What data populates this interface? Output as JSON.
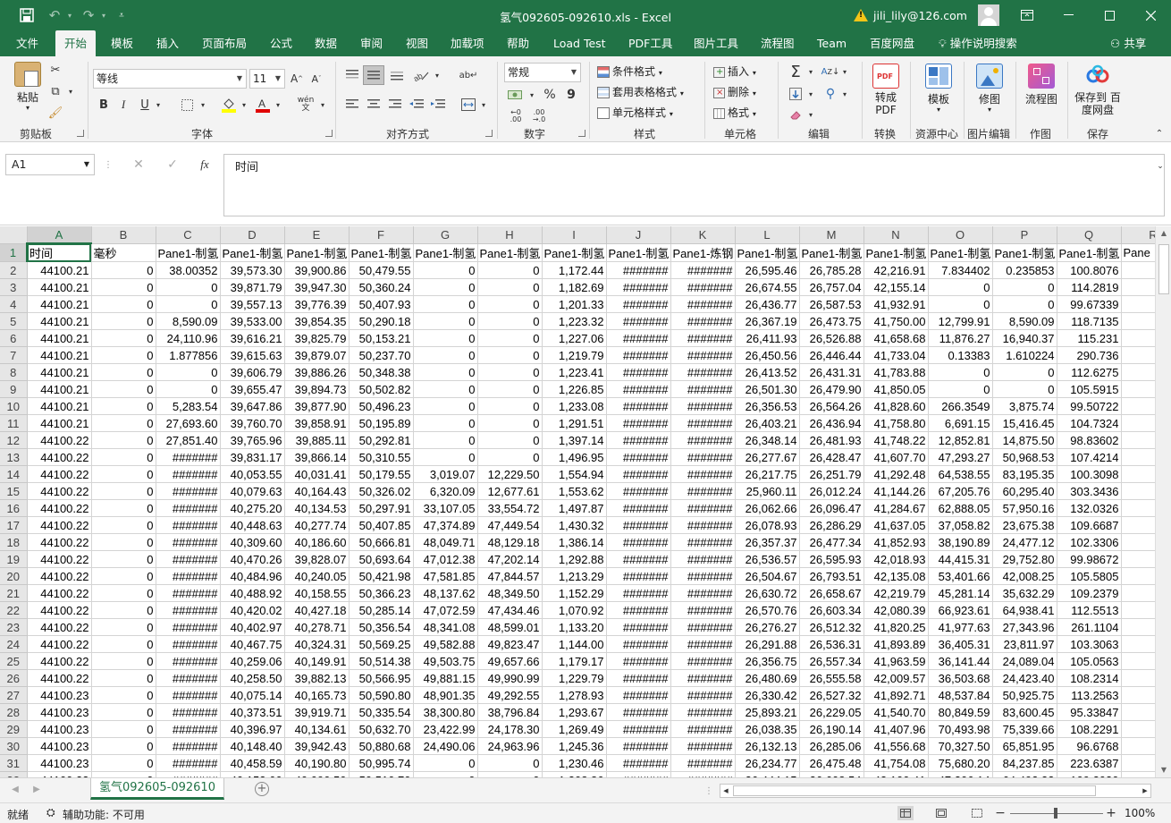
{
  "window": {
    "title": "氢气092605-092610.xls  -  Excel",
    "user": "jili_lily@126.com"
  },
  "colors": {
    "accent": "#217346"
  },
  "tabs": [
    "文件",
    "开始",
    "模板",
    "插入",
    "页面布局",
    "公式",
    "数据",
    "审阅",
    "视图",
    "加载项",
    "帮助",
    "Load Test",
    "PDF工具",
    "图片工具",
    "流程图",
    "Team",
    "百度网盘"
  ],
  "search_hint": "操作说明搜索",
  "share_label": "共享",
  "ribbon": {
    "clipboard": {
      "paste": "粘贴",
      "group": "剪贴板"
    },
    "font": {
      "name": "等线",
      "size": "11",
      "group": "字体",
      "bold": "B",
      "italic": "I",
      "underline": "U",
      "phonetic": "wén"
    },
    "alignment": {
      "group": "对齐方式"
    },
    "number": {
      "format": "常规",
      "group": "数字",
      "percent": "%",
      "comma": "9"
    },
    "styles": {
      "conditional": "条件格式",
      "table": "套用表格格式",
      "cell": "单元格样式",
      "group": "样式"
    },
    "cells": {
      "insert": "插入",
      "delete": "删除",
      "format": "格式",
      "group": "单元格"
    },
    "editing": {
      "group": "编辑"
    },
    "convert": {
      "button": "转成 PDF",
      "group": "转换"
    },
    "resources": {
      "button": "模板",
      "group": "资源中心"
    },
    "imageedit": {
      "button": "修图",
      "group": "图片编辑"
    },
    "drawing": {
      "button": "流程图",
      "group": "作图"
    },
    "save": {
      "button": "保存到 百度网盘",
      "group": "保存"
    }
  },
  "formula": {
    "cell_ref": "A1",
    "content": "时间",
    "fx": "fx"
  },
  "columns": [
    "A",
    "B",
    "C",
    "D",
    "E",
    "F",
    "G",
    "H",
    "I",
    "J",
    "K",
    "L",
    "M",
    "N",
    "O",
    "P",
    "Q",
    "R"
  ],
  "header_row": [
    "时间",
    "毫秒",
    "Pane1-制氢",
    "Pane1-制氢",
    "Pane1-制氢",
    "Pane1-制氢",
    "Pane1-制氢",
    "Pane1-制氢",
    "Pane1-制氢",
    "Pane1-制氢",
    "Pane1-炼钢",
    "Pane1-制氢",
    "Pane1-制氢",
    "Pane1-制氢",
    "Pane1-制氢",
    "Pane1-制氢",
    "Pane1-制氢",
    "Pane"
  ],
  "rows": [
    [
      "44100.21",
      "0",
      "38.00352",
      "39,573.30",
      "39,900.86",
      "50,479.55",
      "0",
      "0",
      "1,172.44",
      "#######",
      "#######",
      "26,595.46",
      "26,785.28",
      "42,216.91",
      "7.834402",
      "0.235853",
      "100.8076",
      "16,6"
    ],
    [
      "44100.21",
      "0",
      "0",
      "39,871.79",
      "39,947.30",
      "50,360.24",
      "0",
      "0",
      "1,182.69",
      "#######",
      "#######",
      "26,674.55",
      "26,757.04",
      "42,155.14",
      "0",
      "0",
      "114.2819",
      "16,6"
    ],
    [
      "44100.21",
      "0",
      "0",
      "39,557.13",
      "39,776.39",
      "50,407.93",
      "0",
      "0",
      "1,201.33",
      "#######",
      "#######",
      "26,436.77",
      "26,587.53",
      "41,932.91",
      "0",
      "0",
      "99.67339",
      "16,6"
    ],
    [
      "44100.21",
      "0",
      "8,590.09",
      "39,533.00",
      "39,854.35",
      "50,290.18",
      "0",
      "0",
      "1,223.32",
      "#######",
      "#######",
      "26,367.19",
      "26,473.75",
      "41,750.00",
      "12,799.91",
      "8,590.09",
      "118.7135",
      "16,6"
    ],
    [
      "44100.21",
      "0",
      "24,110.96",
      "39,616.21",
      "39,825.79",
      "50,153.21",
      "0",
      "0",
      "1,227.06",
      "#######",
      "#######",
      "26,411.93",
      "26,526.88",
      "41,658.68",
      "11,876.27",
      "16,940.37",
      "115.231",
      "16,6"
    ],
    [
      "44100.21",
      "0",
      "1.877856",
      "39,615.63",
      "39,879.07",
      "50,237.70",
      "0",
      "0",
      "1,219.79",
      "#######",
      "#######",
      "26,450.56",
      "26,446.44",
      "41,733.04",
      "0.13383",
      "1.610224",
      "290.736",
      "16,6"
    ],
    [
      "44100.21",
      "0",
      "0",
      "39,606.79",
      "39,886.26",
      "50,348.38",
      "0",
      "0",
      "1,223.41",
      "#######",
      "#######",
      "26,413.52",
      "26,431.31",
      "41,783.88",
      "0",
      "0",
      "112.6275",
      "16,6"
    ],
    [
      "44100.21",
      "0",
      "0",
      "39,655.47",
      "39,894.73",
      "50,502.82",
      "0",
      "0",
      "1,226.85",
      "#######",
      "#######",
      "26,501.30",
      "26,479.90",
      "41,850.05",
      "0",
      "0",
      "105.5915",
      "16,6"
    ],
    [
      "44100.21",
      "0",
      "5,283.54",
      "39,647.86",
      "39,877.90",
      "50,496.23",
      "0",
      "0",
      "1,233.08",
      "#######",
      "#######",
      "26,356.53",
      "26,564.26",
      "41,828.60",
      "266.3549",
      "3,875.74",
      "99.50722",
      "16,6"
    ],
    [
      "44100.21",
      "0",
      "27,693.60",
      "39,760.70",
      "39,858.91",
      "50,195.89",
      "0",
      "0",
      "1,291.51",
      "#######",
      "#######",
      "26,403.21",
      "26,436.94",
      "41,758.80",
      "6,691.15",
      "15,416.45",
      "104.7324",
      "16,6"
    ],
    [
      "44100.22",
      "0",
      "27,851.40",
      "39,765.96",
      "39,885.11",
      "50,292.81",
      "0",
      "0",
      "1,397.14",
      "#######",
      "#######",
      "26,348.14",
      "26,481.93",
      "41,748.22",
      "12,852.81",
      "14,875.50",
      "98.83602",
      "16,6"
    ],
    [
      "44100.22",
      "0",
      "#######",
      "39,831.17",
      "39,866.14",
      "50,310.55",
      "0",
      "0",
      "1,496.95",
      "#######",
      "#######",
      "26,277.67",
      "26,428.47",
      "41,607.70",
      "47,293.27",
      "50,968.53",
      "107.4214",
      "16,6"
    ],
    [
      "44100.22",
      "0",
      "#######",
      "40,053.55",
      "40,031.41",
      "50,179.55",
      "3,019.07",
      "12,229.50",
      "1,554.94",
      "#######",
      "#######",
      "26,217.75",
      "26,251.79",
      "41,292.48",
      "64,538.55",
      "83,195.35",
      "100.3098",
      "16,6"
    ],
    [
      "44100.22",
      "0",
      "#######",
      "40,079.63",
      "40,164.43",
      "50,326.02",
      "6,320.09",
      "12,677.61",
      "1,553.62",
      "#######",
      "#######",
      "25,960.11",
      "26,012.24",
      "41,144.26",
      "67,205.76",
      "60,295.40",
      "303.3436",
      "16,6"
    ],
    [
      "44100.22",
      "0",
      "#######",
      "40,275.20",
      "40,134.53",
      "50,297.91",
      "33,107.05",
      "33,554.72",
      "1,497.87",
      "#######",
      "#######",
      "26,062.66",
      "26,096.47",
      "41,284.67",
      "62,888.05",
      "57,950.16",
      "132.0326",
      "16,6"
    ],
    [
      "44100.22",
      "0",
      "#######",
      "40,448.63",
      "40,277.74",
      "50,407.85",
      "47,374.89",
      "47,449.54",
      "1,430.32",
      "#######",
      "#######",
      "26,078.93",
      "26,286.29",
      "41,637.05",
      "37,058.82",
      "23,675.38",
      "109.6687",
      "16,6"
    ],
    [
      "44100.22",
      "0",
      "#######",
      "40,309.60",
      "40,186.60",
      "50,666.81",
      "48,049.71",
      "48,129.18",
      "1,386.14",
      "#######",
      "#######",
      "26,357.37",
      "26,477.34",
      "41,852.93",
      "38,190.89",
      "24,477.12",
      "102.3306",
      "16,6"
    ],
    [
      "44100.22",
      "0",
      "#######",
      "40,470.26",
      "39,828.07",
      "50,693.64",
      "47,012.38",
      "47,202.14",
      "1,292.88",
      "#######",
      "#######",
      "26,536.57",
      "26,595.93",
      "42,018.93",
      "44,415.31",
      "29,752.80",
      "99.98672",
      "16,6"
    ],
    [
      "44100.22",
      "0",
      "#######",
      "40,484.96",
      "40,240.05",
      "50,421.98",
      "47,581.85",
      "47,844.57",
      "1,213.29",
      "#######",
      "#######",
      "26,504.67",
      "26,793.51",
      "42,135.08",
      "53,401.66",
      "42,008.25",
      "105.5805",
      "16,6"
    ],
    [
      "44100.22",
      "0",
      "#######",
      "40,488.92",
      "40,158.55",
      "50,366.23",
      "48,137.62",
      "48,349.50",
      "1,152.29",
      "#######",
      "#######",
      "26,630.72",
      "26,658.67",
      "42,219.79",
      "45,281.14",
      "35,632.29",
      "109.2379",
      "16,6"
    ],
    [
      "44100.22",
      "0",
      "#######",
      "40,420.02",
      "40,427.18",
      "50,285.14",
      "47,072.59",
      "47,434.46",
      "1,070.92",
      "#######",
      "#######",
      "26,570.76",
      "26,603.34",
      "42,080.39",
      "66,923.61",
      "64,938.41",
      "112.5513",
      "16,6"
    ],
    [
      "44100.22",
      "0",
      "#######",
      "40,402.97",
      "40,278.71",
      "50,356.54",
      "48,341.08",
      "48,599.01",
      "1,133.20",
      "#######",
      "#######",
      "26,276.27",
      "26,512.32",
      "41,820.25",
      "41,977.63",
      "27,343.96",
      "261.1104",
      "16,6"
    ],
    [
      "44100.22",
      "0",
      "#######",
      "40,467.75",
      "40,324.31",
      "50,569.25",
      "49,582.88",
      "49,823.47",
      "1,144.00",
      "#######",
      "#######",
      "26,291.88",
      "26,536.31",
      "41,893.89",
      "36,405.31",
      "23,811.97",
      "103.3063",
      "16,6"
    ],
    [
      "44100.22",
      "0",
      "#######",
      "40,259.06",
      "40,149.91",
      "50,514.38",
      "49,503.75",
      "49,657.66",
      "1,179.17",
      "#######",
      "#######",
      "26,356.75",
      "26,557.34",
      "41,963.59",
      "36,141.44",
      "24,089.04",
      "105.0563",
      "16,6"
    ],
    [
      "44100.22",
      "0",
      "#######",
      "40,258.50",
      "39,882.13",
      "50,566.95",
      "49,881.15",
      "49,990.99",
      "1,229.79",
      "#######",
      "#######",
      "26,480.69",
      "26,555.58",
      "42,009.57",
      "36,503.68",
      "24,423.40",
      "108.2314",
      "16,6"
    ],
    [
      "44100.23",
      "0",
      "#######",
      "40,075.14",
      "40,165.73",
      "50,590.80",
      "48,901.35",
      "49,292.55",
      "1,278.93",
      "#######",
      "#######",
      "26,330.42",
      "26,527.32",
      "41,892.71",
      "48,537.84",
      "50,925.75",
      "113.2563",
      "16,6"
    ],
    [
      "44100.23",
      "0",
      "#######",
      "40,373.51",
      "39,919.71",
      "50,335.54",
      "38,300.80",
      "38,796.84",
      "1,293.67",
      "#######",
      "#######",
      "25,893.21",
      "26,229.05",
      "41,540.70",
      "80,849.59",
      "83,600.45",
      "95.33847",
      "16,6"
    ],
    [
      "44100.23",
      "0",
      "#######",
      "40,396.97",
      "40,134.61",
      "50,632.70",
      "23,422.99",
      "24,178.30",
      "1,269.49",
      "#######",
      "#######",
      "26,038.35",
      "26,190.14",
      "41,407.96",
      "70,493.98",
      "75,339.66",
      "108.2291",
      "16,6"
    ],
    [
      "44100.23",
      "0",
      "#######",
      "40,148.40",
      "39,942.43",
      "50,880.68",
      "24,490.06",
      "24,963.96",
      "1,245.36",
      "#######",
      "#######",
      "26,132.13",
      "26,285.06",
      "41,556.68",
      "70,327.50",
      "65,851.95",
      "96.6768",
      "16,6"
    ],
    [
      "44100.23",
      "0",
      "#######",
      "40,458.59",
      "40,190.80",
      "50,995.74",
      "0",
      "0",
      "1,230.46",
      "#######",
      "#######",
      "26,234.77",
      "26,475.48",
      "41,754.08",
      "75,680.20",
      "84,237.85",
      "223.6387",
      "16,6"
    ],
    [
      "44100.23",
      "0",
      "#######",
      "40,153.66",
      "40,090.50",
      "50,510.70",
      "0",
      "0",
      "1,208.86",
      "#######",
      "#######",
      "26,444.15",
      "26,608.54",
      "42,100.41",
      "47,206.14",
      "64,492.32",
      "109.2030",
      "16,6"
    ]
  ],
  "sheet_tab": "氢气092605-092610",
  "status": {
    "ready": "就绪",
    "accessibility": "辅助功能: 不可用",
    "zoom": "100%"
  }
}
